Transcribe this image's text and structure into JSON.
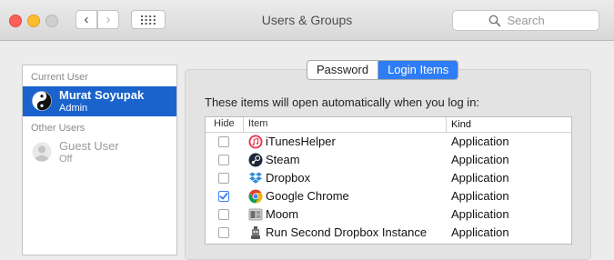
{
  "window": {
    "title": "Users & Groups",
    "back_glyph": "‹",
    "forward_glyph": "›"
  },
  "search": {
    "placeholder": "Search"
  },
  "sidebar": {
    "current_user_label": "Current User",
    "current_user": {
      "name": "Murat Soyupak",
      "role": "Admin"
    },
    "other_users_label": "Other Users",
    "other_users": [
      {
        "name": "Guest User",
        "role": "Off"
      }
    ]
  },
  "tabs": [
    {
      "label": "Password",
      "active": false
    },
    {
      "label": "Login Items",
      "active": true
    }
  ],
  "login_items": {
    "description": "These items will open automatically when you log in:",
    "columns": {
      "hide": "Hide",
      "item": "Item",
      "kind": "Kind"
    },
    "rows": [
      {
        "name": "iTunesHelper",
        "kind": "Application",
        "hide": false,
        "icon": "itunes-icon"
      },
      {
        "name": "Steam",
        "kind": "Application",
        "hide": false,
        "icon": "steam-icon"
      },
      {
        "name": "Dropbox",
        "kind": "Application",
        "hide": false,
        "icon": "dropbox-icon"
      },
      {
        "name": "Google Chrome",
        "kind": "Application",
        "hide": true,
        "icon": "chrome-icon"
      },
      {
        "name": "Moom",
        "kind": "Application",
        "hide": false,
        "icon": "moom-icon"
      },
      {
        "name": "Run Second Dropbox Instance",
        "kind": "Application",
        "hide": false,
        "icon": "automator-icon"
      }
    ]
  },
  "colors": {
    "selection": "#1a63cc",
    "active_tab": "#2f7df6",
    "close": "#fc5f57",
    "minimize": "#fdbc2e"
  }
}
